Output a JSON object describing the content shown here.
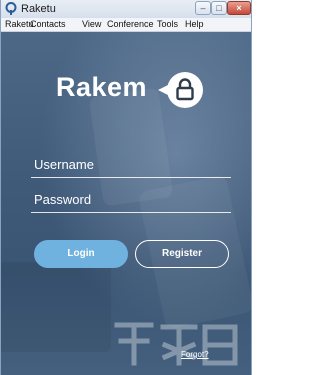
{
  "window": {
    "title": "Raketu",
    "icon": "raketu-app-icon",
    "controls": {
      "minimize": "–",
      "maximize": "□",
      "close": "×"
    }
  },
  "menu": {
    "items": [
      "Raketu",
      "Contacts",
      "View",
      "Conference",
      "Tools",
      "Help"
    ]
  },
  "login": {
    "brand": "Rakem",
    "lock_icon": "lock-icon",
    "username_placeholder": "Username",
    "password_placeholder": "Password",
    "login_label": "Login",
    "register_label": "Register",
    "forgot_label": "Forgot?"
  },
  "colors": {
    "accent": "#6fb2e0",
    "background": "#425d7c",
    "text": "#ffffff"
  }
}
